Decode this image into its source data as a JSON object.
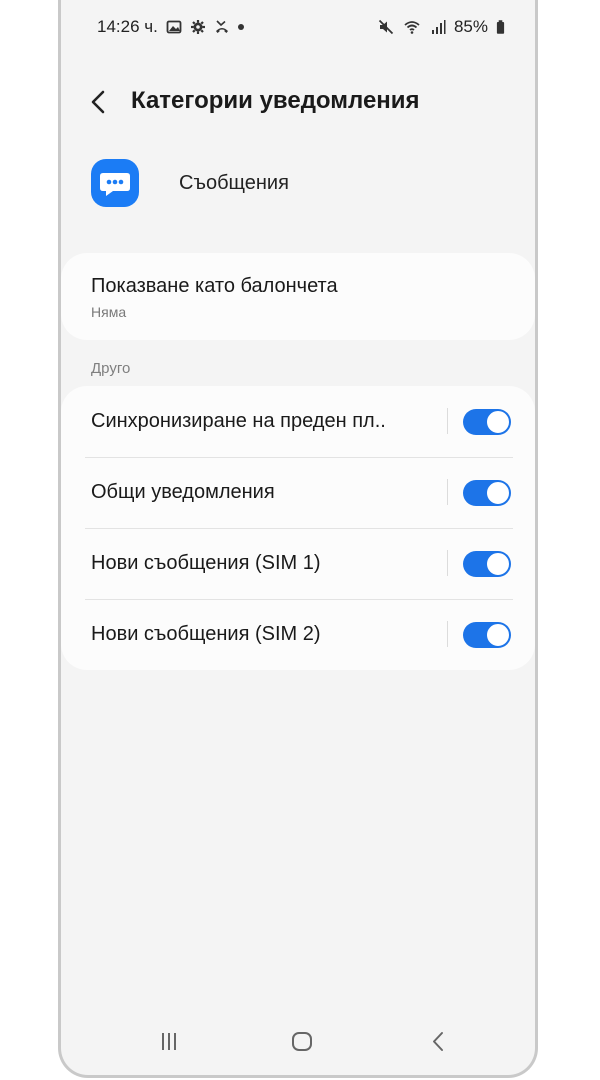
{
  "status_bar": {
    "time": "14:26 ч.",
    "battery": "85%",
    "left_icons": [
      "gallery-icon",
      "gear-icon",
      "missed-call-icon",
      "dot-icon"
    ],
    "right_icons": [
      "mute-icon",
      "wifi-icon",
      "signal-icon",
      "battery-icon"
    ]
  },
  "header": {
    "title": "Категории уведомления",
    "back_icon": "chevron-left-icon"
  },
  "app": {
    "name": "Съобщения",
    "icon": "messages-app-icon",
    "icon_color": "#1b7cf5"
  },
  "bubbles": {
    "title": "Показване като балончета",
    "value": "Няма"
  },
  "other": {
    "label": "Друго",
    "items": [
      {
        "label": "Синхронизиране на преден пл..",
        "enabled": true
      },
      {
        "label": "Общи уведомления",
        "enabled": true
      },
      {
        "label": "Нови съобщения (SIM 1)",
        "enabled": true
      },
      {
        "label": "Нови съобщения (SIM 2)",
        "enabled": true
      }
    ]
  },
  "nav": {
    "recents_icon": "recents-icon",
    "home_icon": "home-icon",
    "back_icon": "back-icon"
  },
  "colors": {
    "accent": "#1d74e8",
    "background": "#f4f4f4",
    "card": "#fcfcfc"
  }
}
